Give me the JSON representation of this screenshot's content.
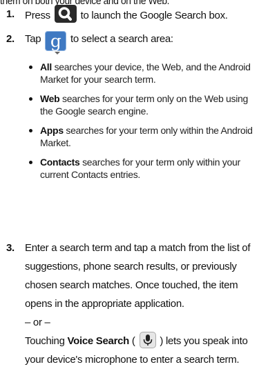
{
  "cut_line": "them on both your device and on the Web.",
  "steps": {
    "s1": {
      "num": "1.",
      "before": "Press",
      "after": "to launch the Google Search box.",
      "icon": "search-icon"
    },
    "s2": {
      "num": "2.",
      "before": "Tap",
      "after": "to select a search area:",
      "icon": "google-g-icon"
    },
    "s3": {
      "num": "3.",
      "text": "Enter a search term and tap a match from the list of suggestions, phone search results, or previously chosen search matches. Once touched, the item opens in the appropriate application.",
      "or": "– or –",
      "voice_before": "Touching",
      "voice_bold": "Voice Search",
      "voice_paren_open": "(",
      "voice_paren_close": ")",
      "voice_after": "lets you speak into your device's microphone to enter a search term.",
      "icon": "microphone-icon"
    }
  },
  "bullets": [
    {
      "bold": "All",
      "text": "searches your device, the Web, and the Android Market for your search term."
    },
    {
      "bold": "Web",
      "text": "searches for your term only on the Web using the Google search engine."
    },
    {
      "bold": "Apps",
      "text": "searches for your term only within the Android Market."
    },
    {
      "bold": "Contacts",
      "text": "searches for your term only within your current Contacts entries."
    }
  ]
}
